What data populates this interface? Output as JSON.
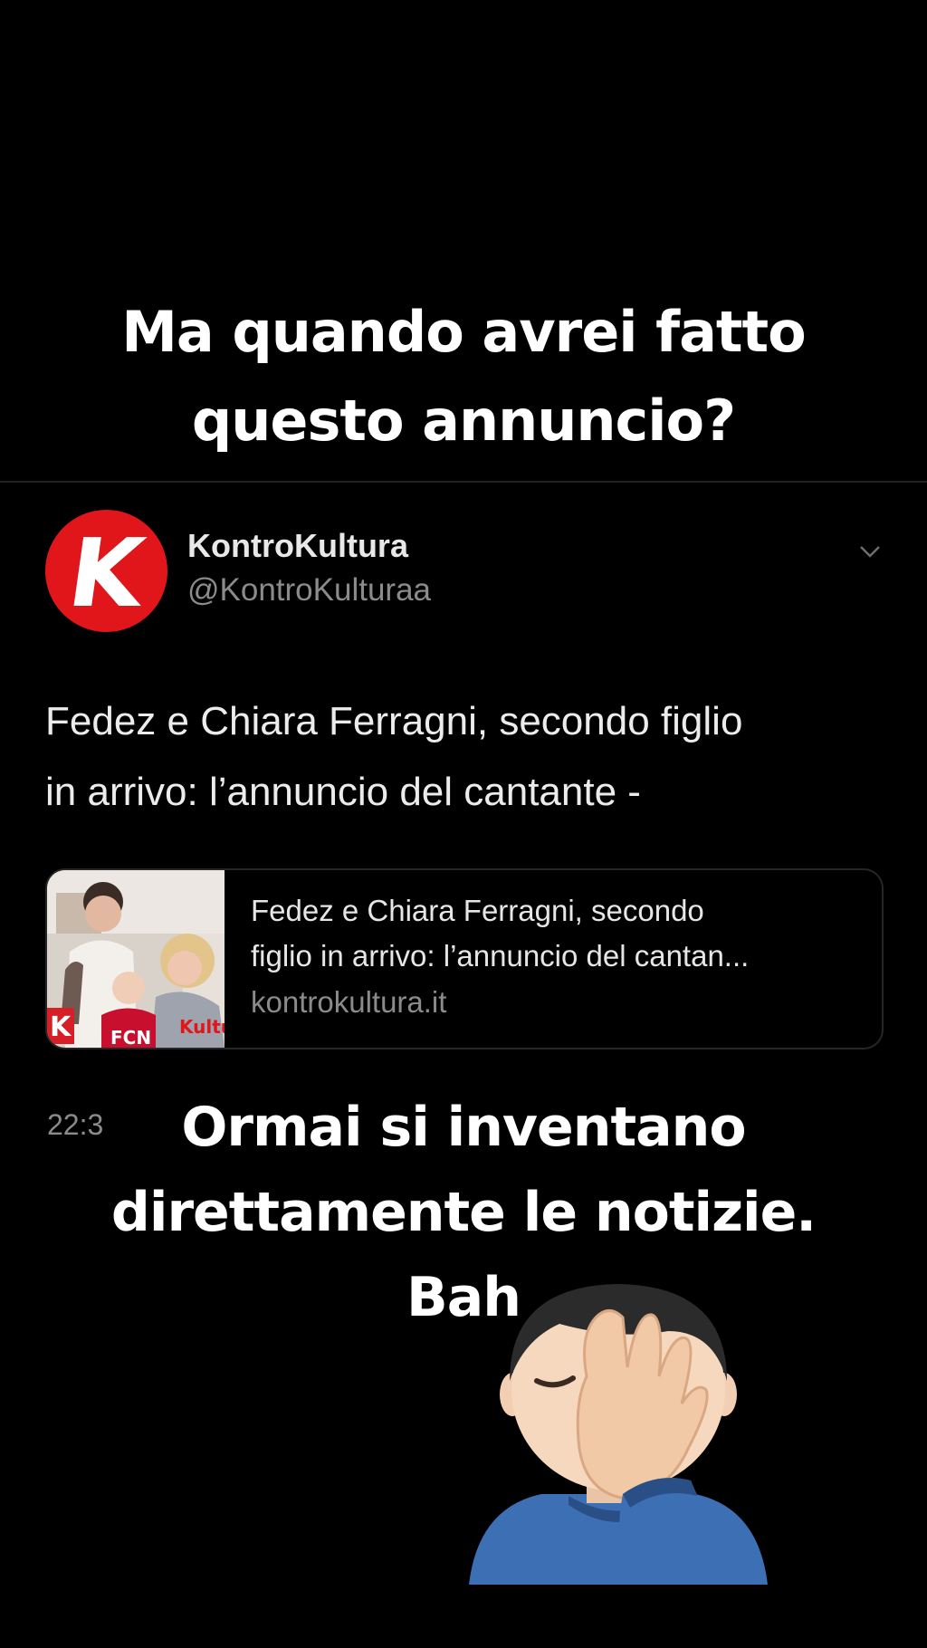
{
  "story": {
    "top_caption": [
      "Ma quando avrei fatto",
      "questo annuncio?"
    ],
    "bottom_caption": [
      "Ormai si inventano",
      "direttamente le notizie.",
      "Bah"
    ],
    "emoji_icon": "man-facepalming-icon"
  },
  "tweet": {
    "avatar_letter": "K",
    "display_name": "KontroKultura",
    "handle": "@KontroKulturaa",
    "text": [
      "Fedez e Chiara Ferragni, secondo figlio",
      "in arrivo: l’annuncio del cantante -"
    ],
    "card": {
      "title": [
        "Fedez e Chiara Ferragni, secondo",
        "figlio in arrivo: l’annuncio del cantan..."
      ],
      "domain": "kontrokultura.it",
      "thumb_caption": "Kultur"
    },
    "timestamp": "22:3"
  },
  "colors": {
    "background": "#000000",
    "brand_red": "#e0161b",
    "secondary_text": "#8b8b8b"
  }
}
